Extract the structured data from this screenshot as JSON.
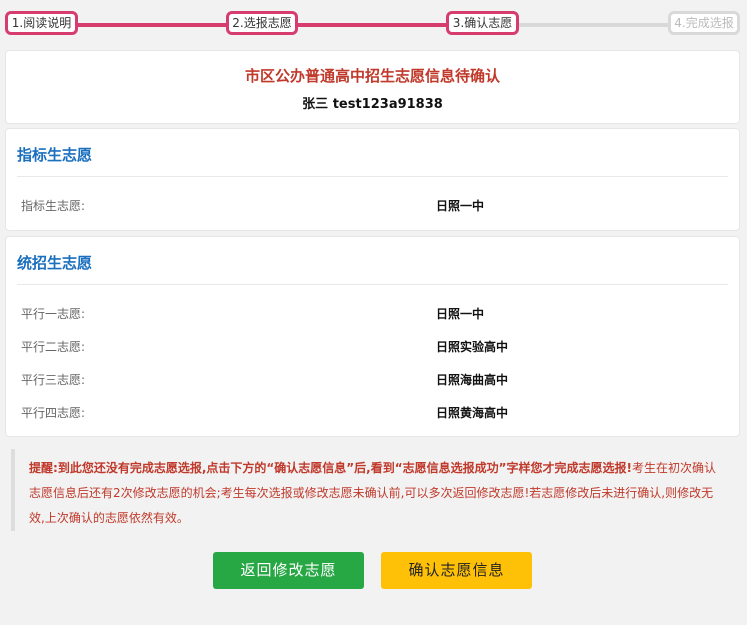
{
  "steps": [
    {
      "label": "1.阅读说明",
      "state": "active"
    },
    {
      "label": "2.选报志愿",
      "state": "active"
    },
    {
      "label": "3.确认志愿",
      "state": "active"
    },
    {
      "label": "4.完成选报",
      "state": "inactive"
    }
  ],
  "header": {
    "title": "市区公办普通高中招生志愿信息待确认",
    "student": "张三  test123a91838"
  },
  "quota_section": {
    "title": "指标生志愿",
    "rows": [
      {
        "label": "指标生志愿:",
        "value": "日照一中"
      }
    ]
  },
  "unified_section": {
    "title": "统招生志愿",
    "rows": [
      {
        "label": "平行一志愿:",
        "value": "日照一中"
      },
      {
        "label": "平行二志愿:",
        "value": "日照实验高中"
      },
      {
        "label": "平行三志愿:",
        "value": "日照海曲高中"
      },
      {
        "label": "平行四志愿:",
        "value": "日照黄海高中"
      }
    ]
  },
  "notice": {
    "prefix": "提醒:",
    "bold_text": "到此您还没有完成志愿选报,点击下方的“确认志愿信息”后,看到“志愿信息选报成功”字样您才完成志愿选报!",
    "normal_text": "考生在初次确认志愿信息后还有2次修改志愿的机会;考生每次选报或修改志愿未确认前,可以多次返回修改志愿!若志愿修改后未进行确认,则修改无效,上次确认的志愿依然有效。"
  },
  "buttons": {
    "back": "返回修改志愿",
    "confirm": "确认志愿信息"
  },
  "colors": {
    "step_active": "#d63c6e",
    "title": "#c0392b",
    "section_title": "#1a6fbf",
    "back_button": "#28a745",
    "confirm_button": "#ffc107"
  }
}
